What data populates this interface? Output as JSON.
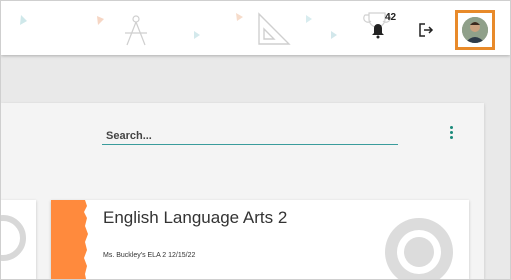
{
  "header": {
    "points_badge_count": "42",
    "trophy_icon": "trophy-bell-icon",
    "logout_icon": "logout-icon",
    "avatar_icon": "user-avatar"
  },
  "search": {
    "placeholder": "Search..."
  },
  "course_card": {
    "title": "English Language Arts 2",
    "subtitle": "Ms. Buckley's ELA 2 12/15/22",
    "accent_color": "#ff8a3d"
  },
  "colors": {
    "avatar_border": "#e88a2a",
    "search_underline": "#3a9c9c",
    "kebab": "#1a8a7a"
  }
}
